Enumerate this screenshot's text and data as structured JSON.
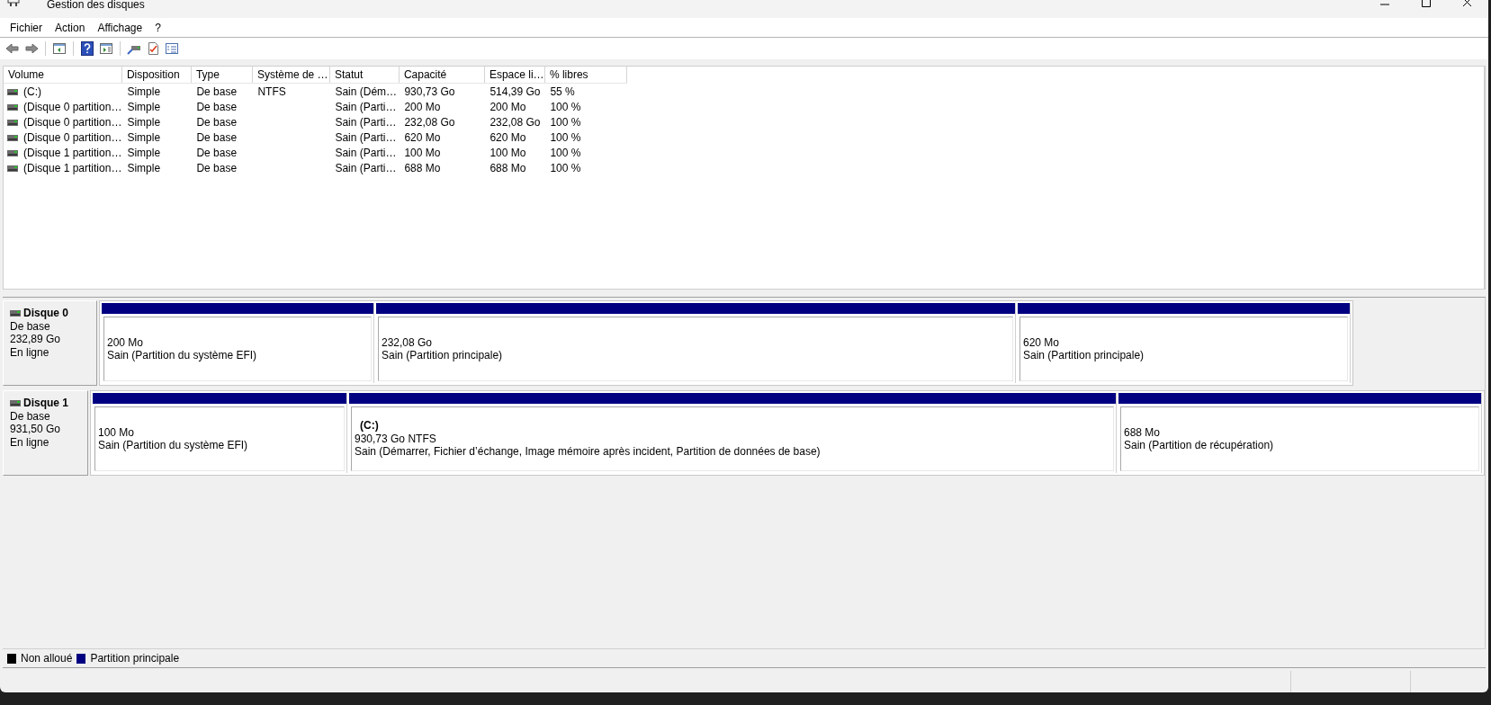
{
  "window": {
    "title": "Gestion des disques"
  },
  "menu": [
    "Fichier",
    "Action",
    "Affichage",
    "?"
  ],
  "volumes": {
    "columns": [
      "Volume",
      "Disposition",
      "Type",
      "Système de …",
      "Statut",
      "Capacité",
      "Espace li…",
      "% libres"
    ],
    "rows": [
      [
        "(C:)",
        "Simple",
        "De base",
        "NTFS",
        "Sain (Dém…",
        "930,73 Go",
        "514,39 Go",
        "55 %"
      ],
      [
        "(Disque 0 partition…",
        "Simple",
        "De base",
        "",
        "Sain (Parti…",
        "200 Mo",
        "200 Mo",
        "100 %"
      ],
      [
        "(Disque 0 partition…",
        "Simple",
        "De base",
        "",
        "Sain (Parti…",
        "232,08 Go",
        "232,08 Go",
        "100 %"
      ],
      [
        "(Disque 0 partition…",
        "Simple",
        "De base",
        "",
        "Sain (Parti…",
        "620 Mo",
        "620 Mo",
        "100 %"
      ],
      [
        "(Disque 1 partition…",
        "Simple",
        "De base",
        "",
        "Sain (Parti…",
        "100 Mo",
        "100 Mo",
        "100 %"
      ],
      [
        "(Disque 1 partition…",
        "Simple",
        "De base",
        "",
        "Sain (Parti…",
        "688 Mo",
        "688 Mo",
        "100 %"
      ]
    ]
  },
  "disks": [
    {
      "name": "Disque 0",
      "type": "De base",
      "size": "232,89 Go",
      "status": "En ligne",
      "partitions": [
        {
          "kind": "primary",
          "size": "200 Mo",
          "status": "Sain (Partition du système EFI)"
        },
        {
          "kind": "primary",
          "size": "232,08 Go",
          "status": "Sain (Partition principale)"
        },
        {
          "kind": "primary",
          "size": "620 Mo",
          "status": "Sain (Partition principale)"
        }
      ]
    },
    {
      "name": "Disque 1",
      "type": "De base",
      "size": "931,50 Go",
      "status": "En ligne",
      "partitions": [
        {
          "kind": "primary",
          "size": "100 Mo",
          "status": "Sain (Partition du système EFI)"
        },
        {
          "kind": "primary",
          "volume": "(C:)",
          "size": "930,73 Go NTFS",
          "status": "Sain (Démarrer, Fichier d’échange, Image mémoire après incident, Partition de données de base)"
        },
        {
          "kind": "primary",
          "size": "688 Mo",
          "status": "Sain (Partition de récupération)"
        }
      ]
    }
  ],
  "legend": [
    {
      "label": "Non alloué",
      "color": "#000000"
    },
    {
      "label": "Partition principale",
      "color": "#000080"
    }
  ]
}
